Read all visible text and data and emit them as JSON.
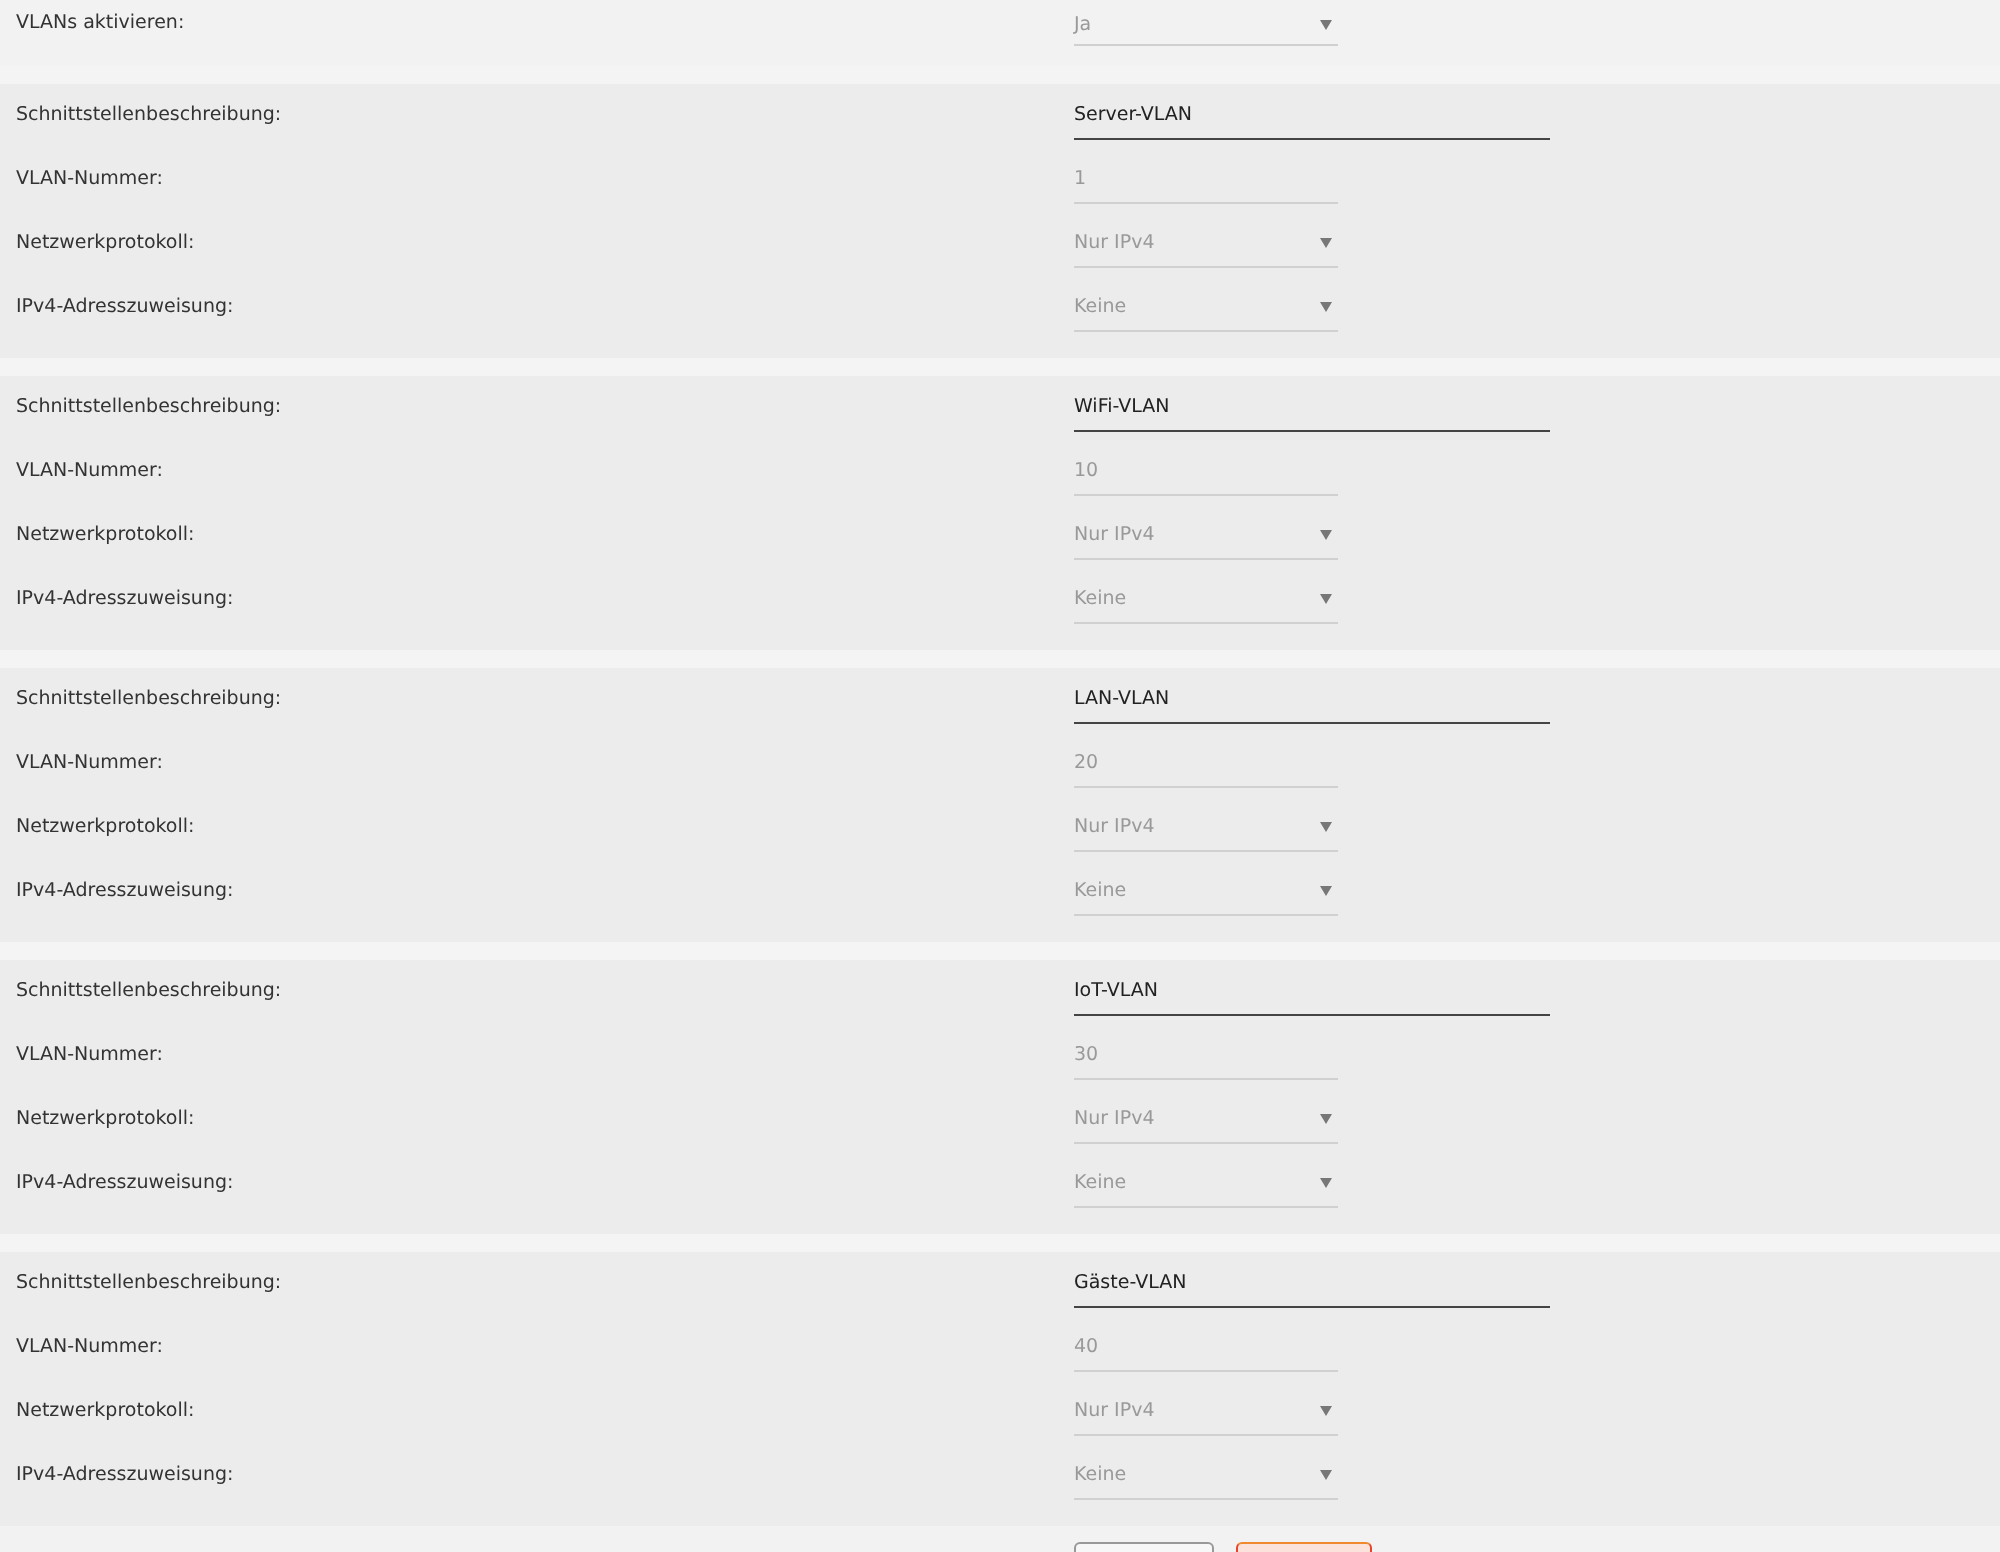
{
  "vlans_enabled": {
    "label": "VLANs aktivieren:",
    "value": "Ja",
    "kind": "select",
    "disabled": true
  },
  "vlans": [
    {
      "fields": [
        {
          "label": "Schnittstellenbeschreibung:",
          "value": "Server-VLAN",
          "kind": "text",
          "disabled": false
        },
        {
          "label": "VLAN-Nummer:",
          "value": "1",
          "kind": "text",
          "disabled": true
        },
        {
          "label": "Netzwerkprotokoll:",
          "value": "Nur IPv4",
          "kind": "select",
          "disabled": true
        },
        {
          "label": "IPv4-Adresszuweisung:",
          "value": "Keine",
          "kind": "select",
          "disabled": true
        }
      ]
    },
    {
      "fields": [
        {
          "label": "Schnittstellenbeschreibung:",
          "value": "WiFi-VLAN",
          "kind": "text",
          "disabled": false
        },
        {
          "label": "VLAN-Nummer:",
          "value": "10",
          "kind": "text",
          "disabled": true
        },
        {
          "label": "Netzwerkprotokoll:",
          "value": "Nur IPv4",
          "kind": "select",
          "disabled": true
        },
        {
          "label": "IPv4-Adresszuweisung:",
          "value": "Keine",
          "kind": "select",
          "disabled": true
        }
      ]
    },
    {
      "fields": [
        {
          "label": "Schnittstellenbeschreibung:",
          "value": "LAN-VLAN",
          "kind": "text",
          "disabled": false
        },
        {
          "label": "VLAN-Nummer:",
          "value": "20",
          "kind": "text",
          "disabled": true
        },
        {
          "label": "Netzwerkprotokoll:",
          "value": "Nur IPv4",
          "kind": "select",
          "disabled": true
        },
        {
          "label": "IPv4-Adresszuweisung:",
          "value": "Keine",
          "kind": "select",
          "disabled": true
        }
      ]
    },
    {
      "fields": [
        {
          "label": "Schnittstellenbeschreibung:",
          "value": "IoT-VLAN",
          "kind": "text",
          "disabled": false
        },
        {
          "label": "VLAN-Nummer:",
          "value": "30",
          "kind": "text",
          "disabled": true
        },
        {
          "label": "Netzwerkprotokoll:",
          "value": "Nur IPv4",
          "kind": "select",
          "disabled": true
        },
        {
          "label": "IPv4-Adresszuweisung:",
          "value": "Keine",
          "kind": "select",
          "disabled": true
        }
      ]
    },
    {
      "fields": [
        {
          "label": "Schnittstellenbeschreibung:",
          "value": "Gäste-VLAN",
          "kind": "text",
          "disabled": false
        },
        {
          "label": "VLAN-Nummer:",
          "value": "40",
          "kind": "text",
          "disabled": true
        },
        {
          "label": "Netzwerkprotokoll:",
          "value": "Nur IPv4",
          "kind": "select",
          "disabled": true
        },
        {
          "label": "IPv4-Adresszuweisung:",
          "value": "Keine",
          "kind": "select",
          "disabled": true
        }
      ]
    }
  ],
  "footer": {
    "buttons": [
      {
        "kind": "secondary"
      },
      {
        "kind": "primary"
      }
    ]
  }
}
